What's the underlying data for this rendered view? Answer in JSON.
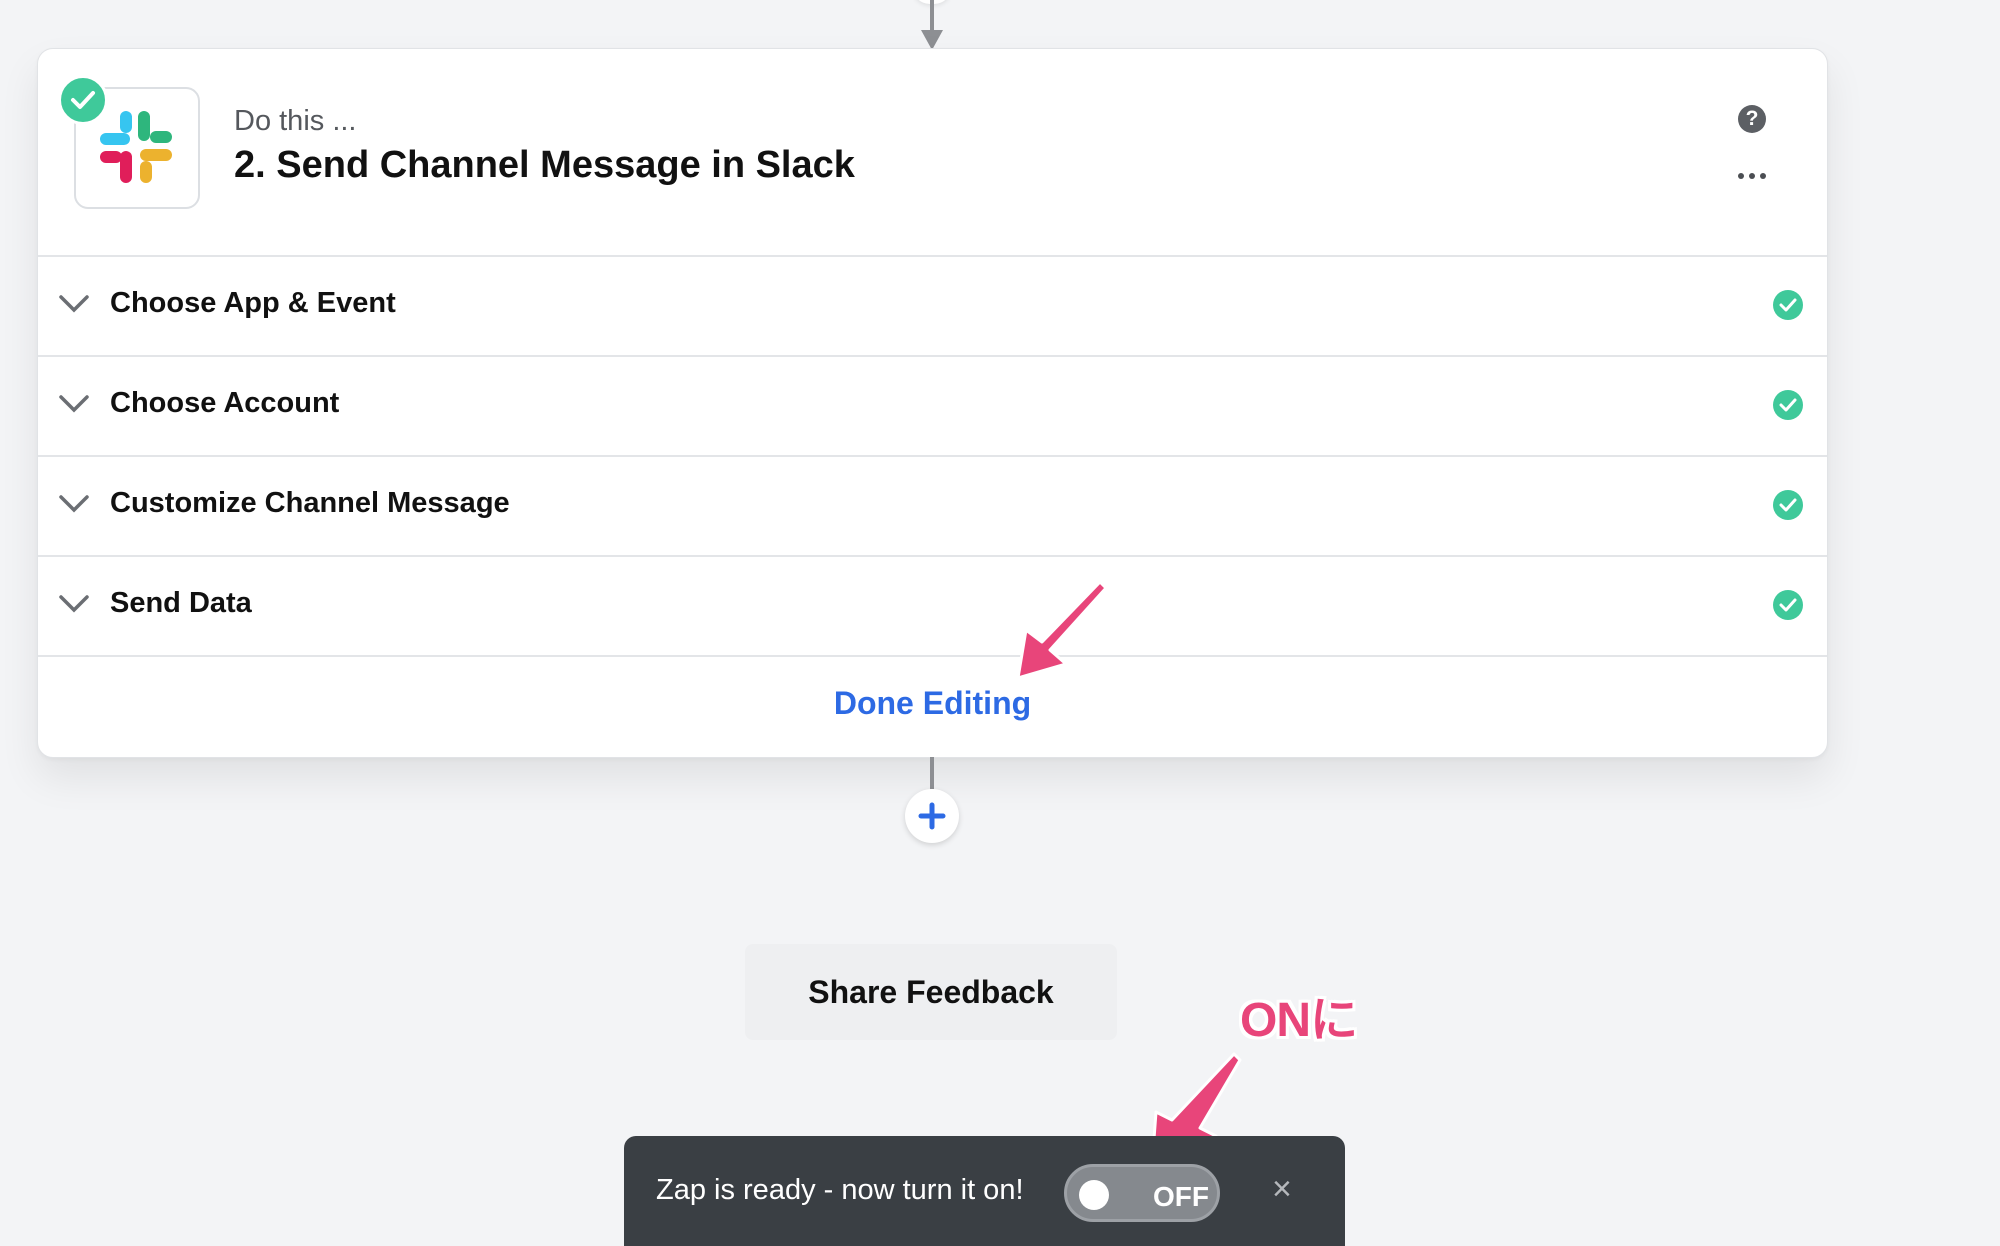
{
  "step": {
    "kicker": "Do this ...",
    "title": "2. Send Channel Message in Slack",
    "app_icon": "slack-logo",
    "status": "complete"
  },
  "header_actions": {
    "help_icon": "question-circle-icon",
    "help_glyph": "?",
    "more_icon": "more-horizontal-icon"
  },
  "sections": [
    {
      "label": "Choose App & Event",
      "status": "complete"
    },
    {
      "label": "Choose Account",
      "status": "complete"
    },
    {
      "label": "Customize Channel Message",
      "status": "complete"
    },
    {
      "label": "Send Data",
      "status": "complete"
    }
  ],
  "done_editing_label": "Done Editing",
  "add_step_icon": "plus-icon",
  "share_feedback_label": "Share Feedback",
  "annotation": {
    "text": "ONに"
  },
  "toast": {
    "message": "Zap is ready - now turn it on!",
    "toggle_label": "OFF",
    "close_glyph": "×"
  },
  "colors": {
    "accent_blue": "#2d6ae4",
    "success_green": "#3fc99a",
    "annotation_pink": "#e8457a",
    "toast_bg": "#3a3f44"
  }
}
